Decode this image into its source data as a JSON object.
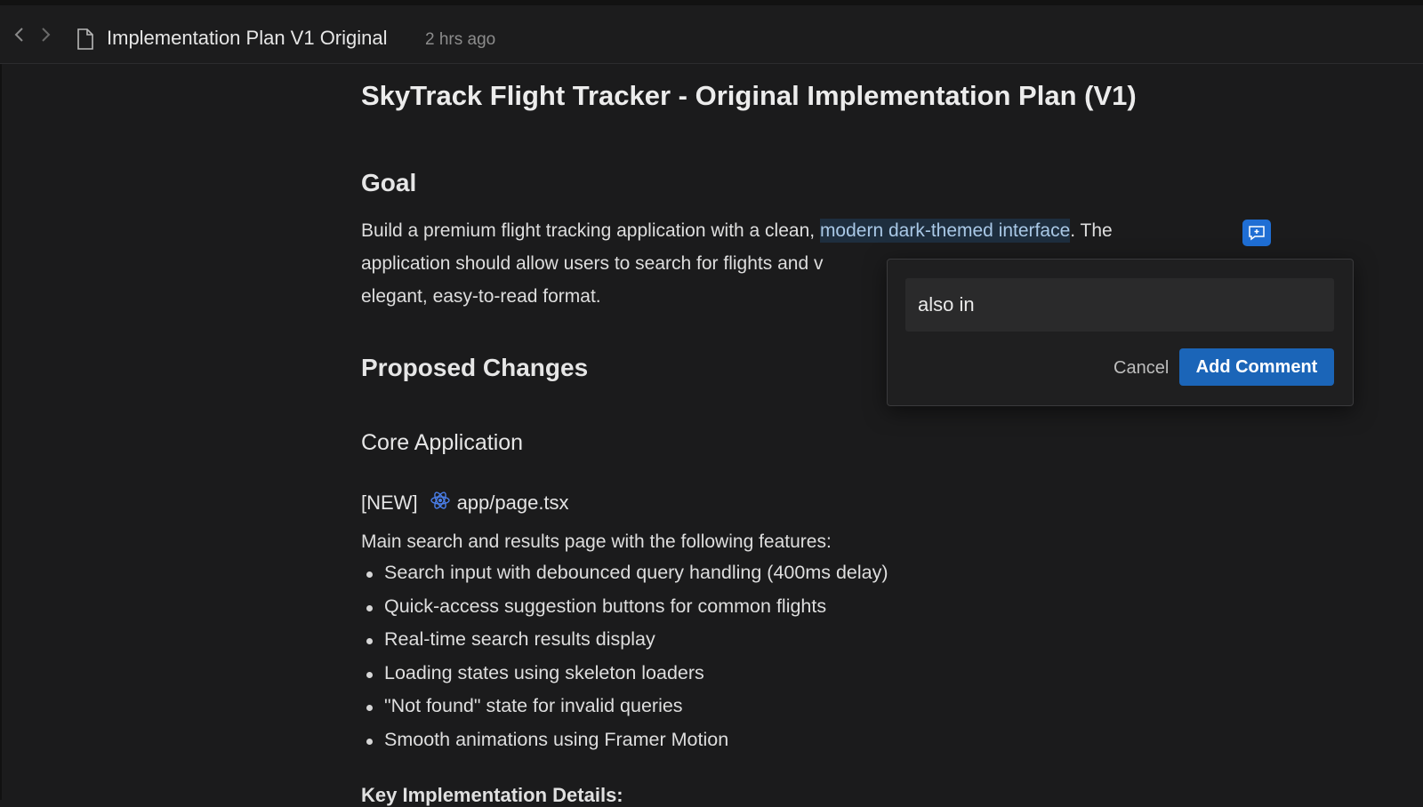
{
  "header": {
    "back_icon": "chevron-left-icon",
    "forward_icon": "chevron-right-icon",
    "file_icon": "document-icon",
    "title": "Implementation Plan V1 Original",
    "time": "2 hrs ago"
  },
  "doc": {
    "title": "SkyTrack Flight Tracker - Original Implementation Plan (V1)",
    "goal_heading": "Goal",
    "goal_line1_before": "Build a premium flight tracking application with a clean, ",
    "goal_line1_highlight": "modern dark-themed interface",
    "goal_line1_after": ". The",
    "goal_line2": "application should allow users to search for flights and v",
    "goal_line3": "elegant, easy-to-read format.",
    "proposed_heading": "Proposed Changes",
    "core_heading": "Core Application",
    "new_tag": "[NEW]",
    "file_name": "app/page.tsx",
    "main_desc": "Main search and results page with the following features:",
    "features": [
      "Search input with debounced query handling (400ms delay)",
      "Quick-access suggestion buttons for common flights",
      "Real-time search results display",
      "Loading states using skeleton loaders",
      "\"Not found\" state for invalid queries",
      "Smooth animations using Framer Motion"
    ],
    "cut_heading": "Key Implementation Details:"
  },
  "comment": {
    "trigger_icon": "add-comment-icon",
    "input_value": "also in",
    "cancel_label": "Cancel",
    "add_label": "Add Comment"
  },
  "colors": {
    "background": "#1b1b1c",
    "accent": "#1b65b8",
    "highlight_text": "#a9c8e6"
  }
}
